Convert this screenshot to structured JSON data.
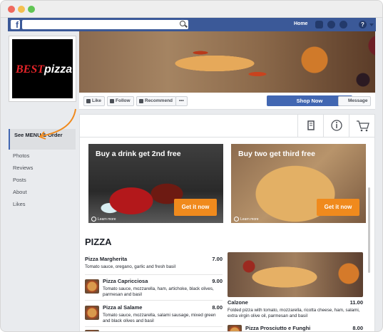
{
  "window": {
    "controls": [
      "close",
      "minimize",
      "zoom"
    ]
  },
  "topbar": {
    "logo": "f",
    "home_label": "Home",
    "icons": [
      "friends-icon",
      "messenger-icon",
      "globe-icon",
      "help-icon"
    ],
    "help_glyph": "?"
  },
  "page": {
    "logo_text_1": "BEST",
    "logo_text_2": "pizza",
    "actions": {
      "like": "Like",
      "follow": "Follow",
      "recommend": "Recommend",
      "more": "•••",
      "shop_now": "Shop Now",
      "message": "Message"
    }
  },
  "sidebar": {
    "items": [
      {
        "label": "See MENU & Order",
        "active": true
      },
      {
        "label": "Photos"
      },
      {
        "label": "Reviews"
      },
      {
        "label": "Posts"
      },
      {
        "label": "About"
      },
      {
        "label": "Likes"
      }
    ]
  },
  "promos": [
    {
      "title": "Buy a drink get 2nd free",
      "button": "Get it now",
      "learn": "Learn more"
    },
    {
      "title": "Buy two get third free",
      "button": "Get it now",
      "learn": "Learn more"
    }
  ],
  "menu": {
    "heading": "PIZZA",
    "items": [
      {
        "name": "Pizza Margherita",
        "price": "7.00",
        "desc": "Tomato sauce, oregano, garlic and fresh basil"
      },
      {
        "name": "Pizza Capricciosa",
        "price": "9.00",
        "desc": "Tomato sauce, mozzarella, ham, artichoke, black olives, parmesan and basil"
      },
      {
        "name": "Pizza al Salame",
        "price": "8.00",
        "desc": "Tomato sauce, mozzarella, salami sausage, mixed green and black olives and basil"
      }
    ],
    "calzone": {
      "name": "Calzone",
      "price": "11.00",
      "desc": "Folded pizza with tomato, mozzarella, ricotta cheese, ham, salami, extra virgin olive oil, parmesan and basil"
    },
    "prosciutto": {
      "name": "Pizza Prosciutto e Funghi",
      "price": "8.00"
    }
  }
}
